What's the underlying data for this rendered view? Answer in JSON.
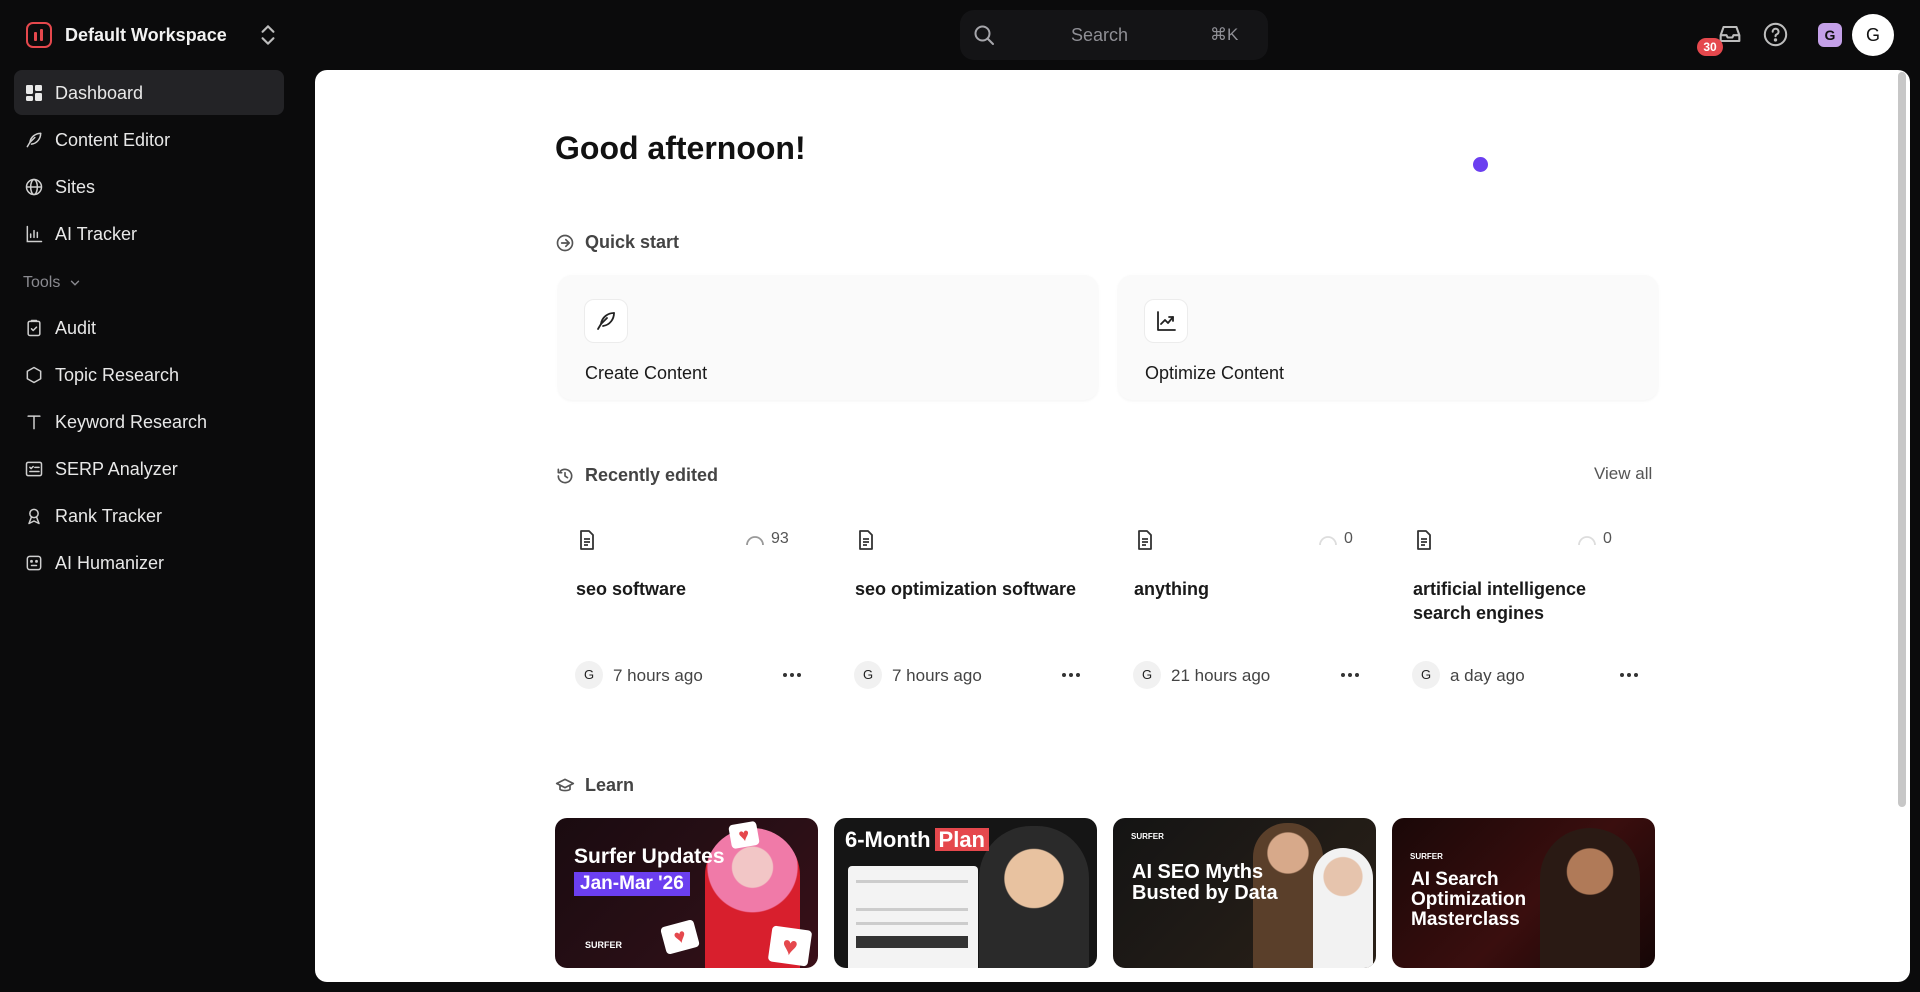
{
  "workspace": {
    "name": "Default Workspace"
  },
  "search": {
    "placeholder": "Search",
    "shortcut": "⌘K"
  },
  "topbar": {
    "notification_count": "30",
    "workspace_avatar": "G",
    "user_avatar": "G"
  },
  "sidebar": {
    "items": [
      {
        "label": "Dashboard",
        "icon": "dashboard-icon",
        "active": true
      },
      {
        "label": "Content Editor",
        "icon": "feather-icon"
      },
      {
        "label": "Sites",
        "icon": "globe-icon"
      },
      {
        "label": "AI Tracker",
        "icon": "chart-icon"
      }
    ],
    "tools_label": "Tools",
    "tools": [
      {
        "label": "Audit",
        "icon": "clipboard-check-icon"
      },
      {
        "label": "Topic Research",
        "icon": "hexagon-icon"
      },
      {
        "label": "Keyword Research",
        "icon": "text-t-icon"
      },
      {
        "label": "SERP Analyzer",
        "icon": "list-check-icon"
      },
      {
        "label": "Rank Tracker",
        "icon": "award-icon"
      },
      {
        "label": "AI Humanizer",
        "icon": "robot-face-icon"
      }
    ]
  },
  "main": {
    "greeting": "Good afternoon!",
    "quick_start": {
      "title": "Quick start",
      "cards": [
        {
          "label": "Create Content",
          "icon": "feather-icon"
        },
        {
          "label": "Optimize Content",
          "icon": "trending-chart-icon"
        }
      ]
    },
    "recently_edited": {
      "title": "Recently edited",
      "view_all": "View all",
      "docs": [
        {
          "title": "seo software",
          "score": "93",
          "avatar": "G",
          "time": "7 hours ago"
        },
        {
          "title": "seo optimization software",
          "score": "",
          "avatar": "G",
          "time": "7 hours ago"
        },
        {
          "title": "anything",
          "score": "0",
          "avatar": "G",
          "time": "21 hours ago"
        },
        {
          "title": "artificial intelligence search engines",
          "score": "0",
          "avatar": "G",
          "time": "a day ago"
        }
      ]
    },
    "learn": {
      "title": "Learn",
      "cards": [
        {
          "title": "Surfer Updates",
          "highlight": "Jan-Mar '26",
          "brand": "SURFER"
        },
        {
          "title": "6-Month",
          "highlight": "Plan"
        },
        {
          "title": "AI SEO Myths Busted by Data",
          "brand": "SURFER"
        },
        {
          "title": "AI Search Optimization Masterclass",
          "brand": "SURFER"
        }
      ]
    }
  },
  "colors": {
    "accent": "#e5484d",
    "purple_dot": "#6b3ff0",
    "page_bg": "#0b0b0c",
    "panel_bg": "#ffffff"
  }
}
